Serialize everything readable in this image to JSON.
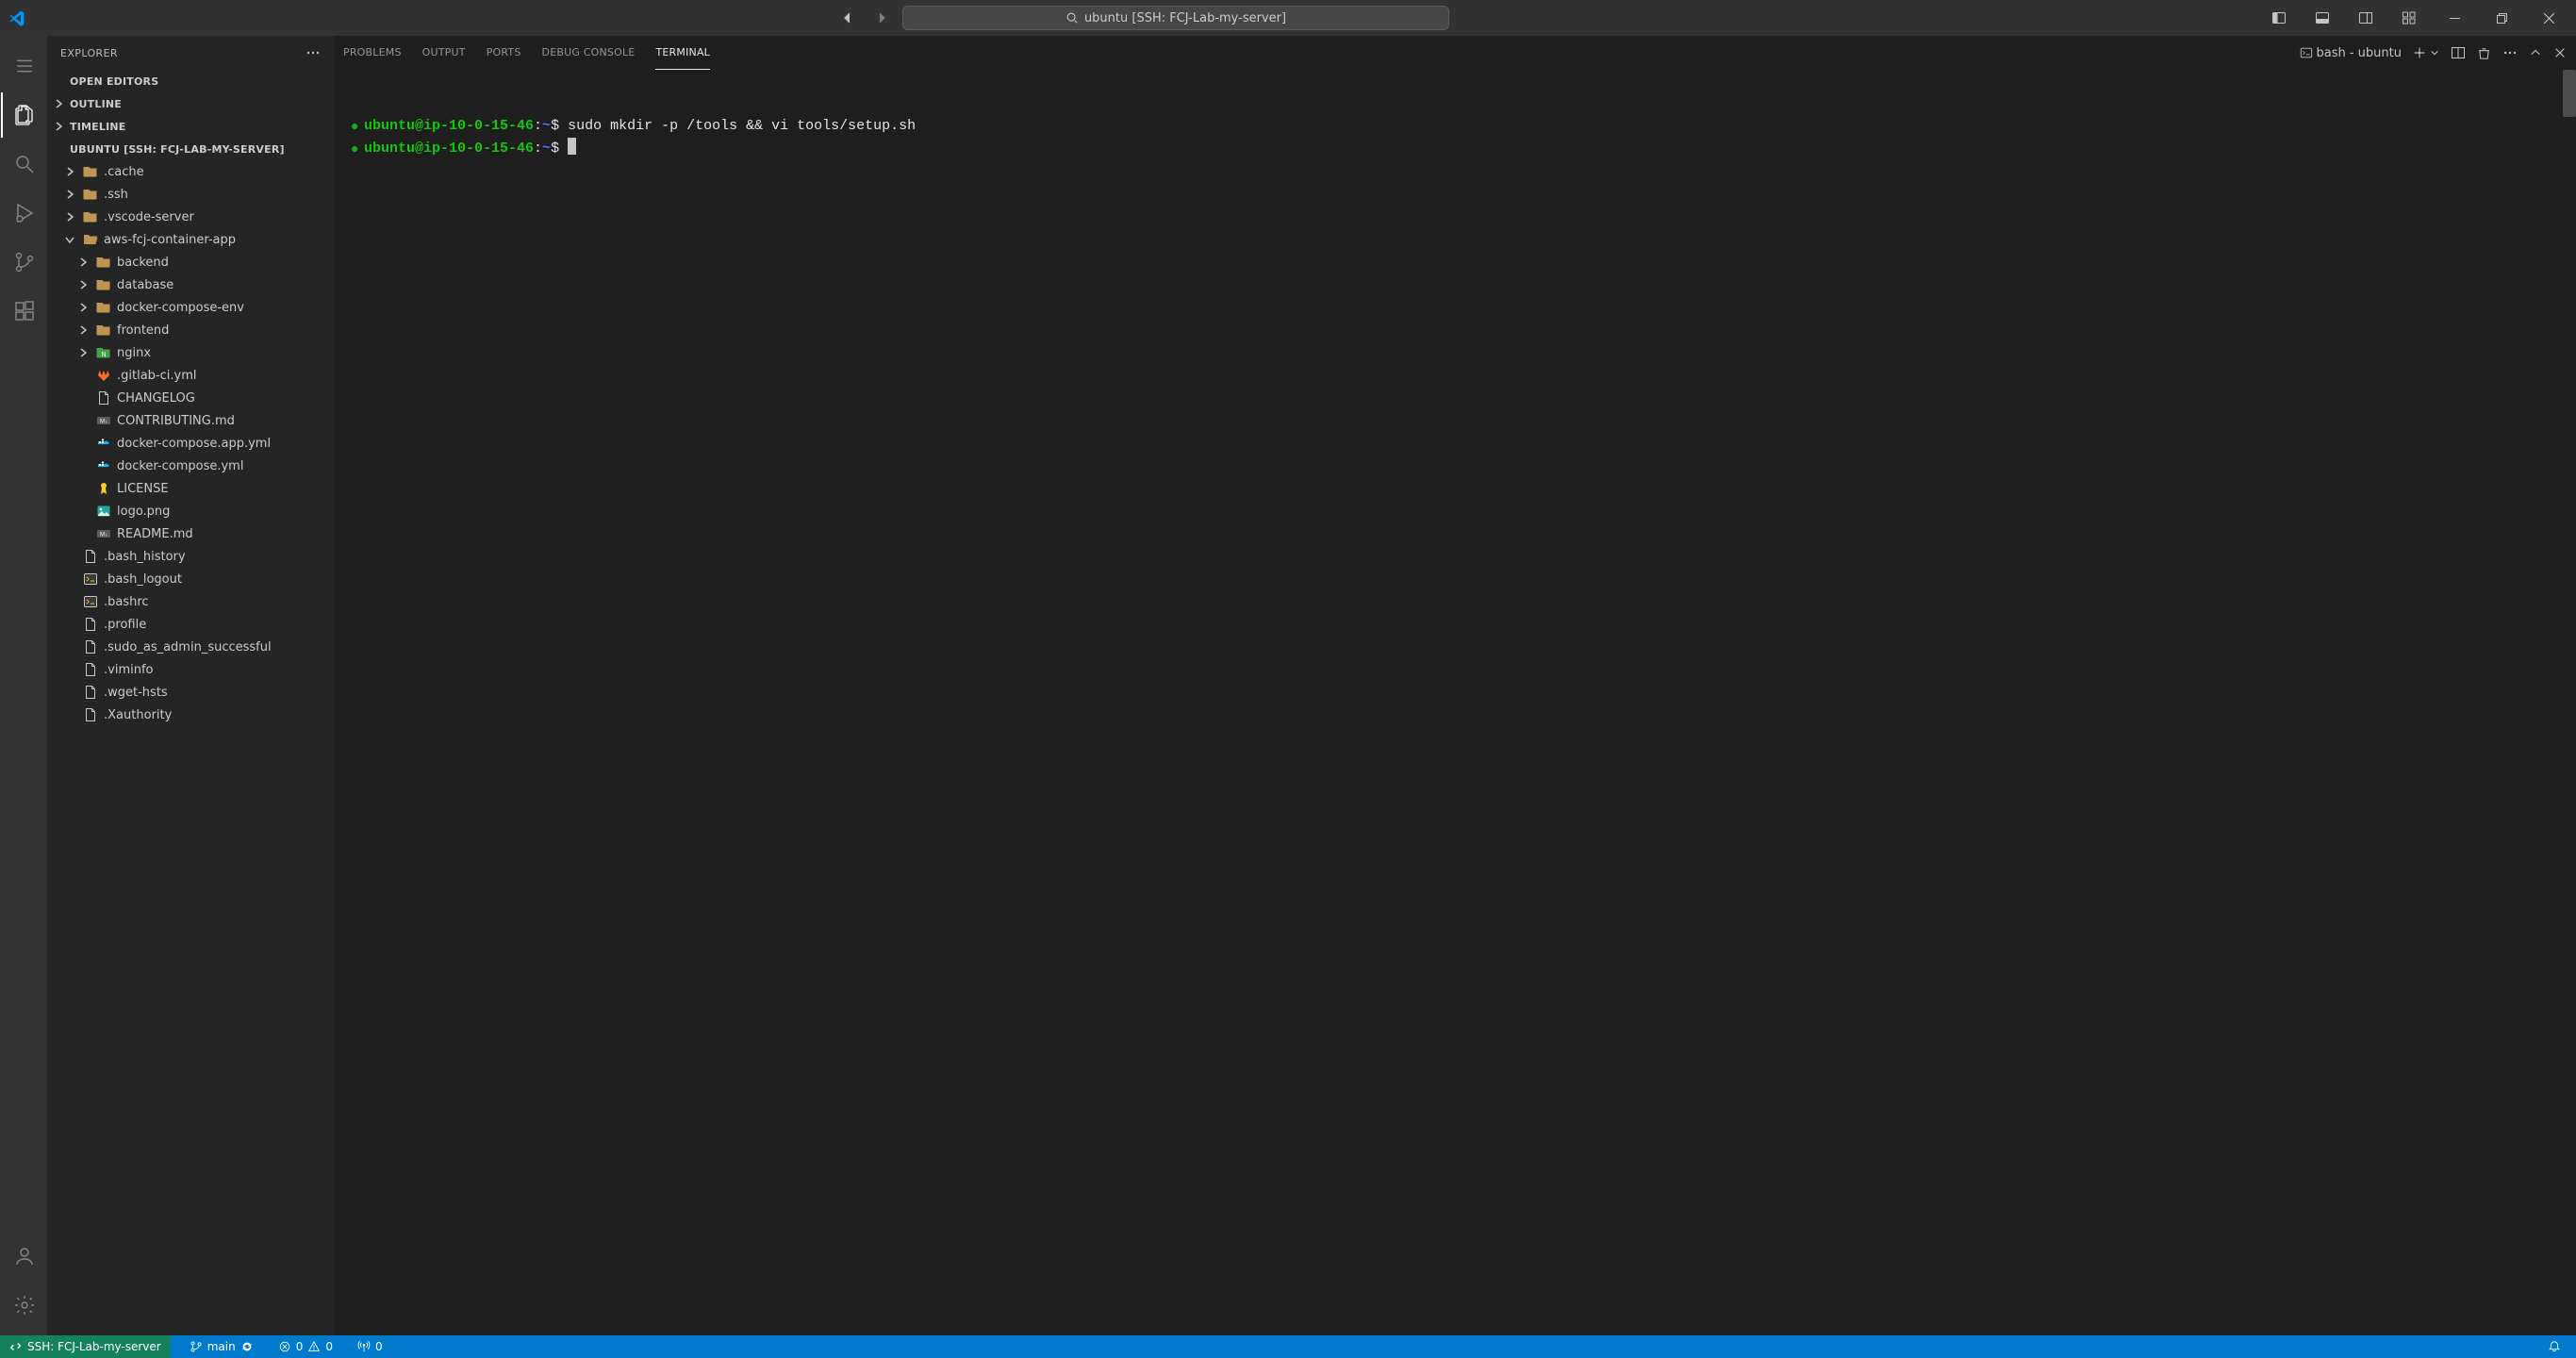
{
  "titlebar": {
    "search_text": "ubuntu [SSH: FCJ-Lab-my-server]"
  },
  "sidebar": {
    "title": "EXPLORER",
    "sections": {
      "open_editors": "OPEN EDITORS",
      "outline": "OUTLINE",
      "timeline": "TIMELINE",
      "workspace": "UBUNTU [SSH: FCJ-LAB-MY-SERVER]"
    },
    "tree": [
      {
        "depth": 1,
        "twisty": "right",
        "icon": "folder",
        "color": "#c09553",
        "label": ".cache"
      },
      {
        "depth": 1,
        "twisty": "right",
        "icon": "folder",
        "color": "#c09553",
        "label": ".ssh"
      },
      {
        "depth": 1,
        "twisty": "right",
        "icon": "folder",
        "color": "#c09553",
        "label": ".vscode-server"
      },
      {
        "depth": 1,
        "twisty": "down",
        "icon": "folder-open",
        "color": "#c09553",
        "label": "aws-fcj-container-app"
      },
      {
        "depth": 2,
        "twisty": "right",
        "icon": "folder",
        "color": "#c09553",
        "label": "backend"
      },
      {
        "depth": 2,
        "twisty": "right",
        "icon": "folder",
        "color": "#c09553",
        "label": "database"
      },
      {
        "depth": 2,
        "twisty": "right",
        "icon": "folder",
        "color": "#c09553",
        "label": "docker-compose-env"
      },
      {
        "depth": 2,
        "twisty": "right",
        "icon": "folder",
        "color": "#c09553",
        "label": "frontend"
      },
      {
        "depth": 2,
        "twisty": "right",
        "icon": "folder-nginx",
        "color": "#43a047",
        "label": "nginx"
      },
      {
        "depth": 2,
        "twisty": "",
        "icon": "gitlab",
        "color": "#fc6d26",
        "label": ".gitlab-ci.yml"
      },
      {
        "depth": 2,
        "twisty": "",
        "icon": "file",
        "color": "#c5c5c5",
        "label": "CHANGELOG"
      },
      {
        "depth": 2,
        "twisty": "",
        "icon": "md",
        "color": "#8a8a8a",
        "label": "CONTRIBUTING.md"
      },
      {
        "depth": 2,
        "twisty": "",
        "icon": "docker",
        "color": "#0db7ed",
        "label": "docker-compose.app.yml"
      },
      {
        "depth": 2,
        "twisty": "",
        "icon": "docker",
        "color": "#0db7ed",
        "label": "docker-compose.yml"
      },
      {
        "depth": 2,
        "twisty": "",
        "icon": "license",
        "color": "#ffca28",
        "label": "LICENSE"
      },
      {
        "depth": 2,
        "twisty": "",
        "icon": "image",
        "color": "#26a69a",
        "label": "logo.png"
      },
      {
        "depth": 2,
        "twisty": "",
        "icon": "md",
        "color": "#8a8a8a",
        "label": "README.md"
      },
      {
        "depth": 1,
        "twisty": "",
        "icon": "file",
        "color": "#c5c5c5",
        "label": ".bash_history"
      },
      {
        "depth": 1,
        "twisty": "",
        "icon": "console",
        "color": "#c5c5c5",
        "label": ".bash_logout"
      },
      {
        "depth": 1,
        "twisty": "",
        "icon": "console",
        "color": "#c5c5c5",
        "label": ".bashrc"
      },
      {
        "depth": 1,
        "twisty": "",
        "icon": "file",
        "color": "#c5c5c5",
        "label": ".profile"
      },
      {
        "depth": 1,
        "twisty": "",
        "icon": "file",
        "color": "#c5c5c5",
        "label": ".sudo_as_admin_successful"
      },
      {
        "depth": 1,
        "twisty": "",
        "icon": "file",
        "color": "#c5c5c5",
        "label": ".viminfo"
      },
      {
        "depth": 1,
        "twisty": "",
        "icon": "file",
        "color": "#c5c5c5",
        "label": ".wget-hsts"
      },
      {
        "depth": 1,
        "twisty": "",
        "icon": "file",
        "color": "#c5c5c5",
        "label": ".Xauthority"
      }
    ]
  },
  "panel": {
    "tabs": {
      "problems": "PROBLEMS",
      "output": "OUTPUT",
      "ports": "PORTS",
      "debug_console": "DEBUG CONSOLE",
      "terminal": "TERMINAL"
    },
    "shell_label": "bash - ubuntu"
  },
  "terminal": {
    "lines": [
      {
        "user": "ubuntu@ip-10-0-15-46",
        "sep": ":",
        "path": "~",
        "dollar": "$ ",
        "cmd": "sudo mkdir -p /tools && vi tools/setup.sh"
      },
      {
        "user": "ubuntu@ip-10-0-15-46",
        "sep": ":",
        "path": "~",
        "dollar": "$ ",
        "cmd": ""
      }
    ]
  },
  "statusbar": {
    "remote": "SSH: FCJ-Lab-my-server",
    "branch": "main",
    "errors": "0",
    "warnings": "0",
    "ports": "0"
  }
}
